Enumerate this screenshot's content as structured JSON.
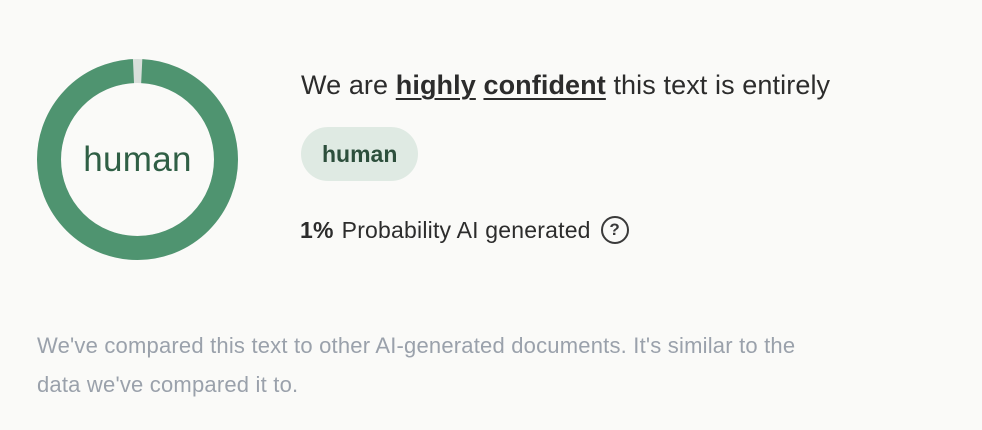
{
  "donut": {
    "label": "human",
    "ai_probability": 0.01,
    "ring_color": "#4f9470",
    "remainder_color": "#d9dfdb"
  },
  "headline": {
    "prefix": "We are ",
    "emphasis_1": "highly",
    "emphasis_2": "confident",
    "suffix": " this text is entirely"
  },
  "classification_badge": "human",
  "probability": {
    "value": "1%",
    "label": "Probability AI generated",
    "help_icon": "question-circle-icon",
    "help_glyph": "?"
  },
  "footnote": "We've compared this text to other AI-generated documents. It's similar to the data we've compared it to."
}
